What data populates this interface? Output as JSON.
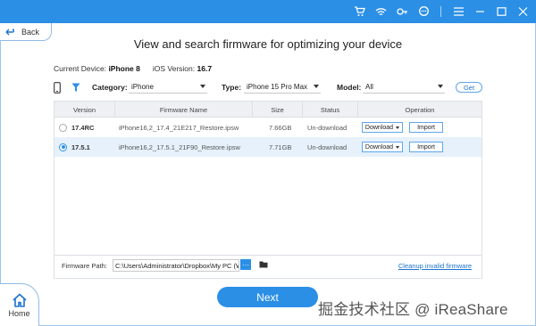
{
  "header": {
    "icons": [
      "cart-icon",
      "wifi-icon",
      "key-icon",
      "chat-icon",
      "menu-icon",
      "minimize-icon",
      "maximize-icon",
      "close-icon"
    ]
  },
  "nav": {
    "back_label": "Back",
    "home_label": "Home"
  },
  "page": {
    "title": "View and search firmware for optimizing your device"
  },
  "device": {
    "current_label": "Current Device:",
    "current_value": "iPhone 8",
    "ios_label": "iOS Version:",
    "ios_value": "16.7"
  },
  "filters": {
    "category_label": "Category:",
    "category_value": "iPhone",
    "type_label": "Type:",
    "type_value": "iPhone 15 Pro Max",
    "model_label": "Model:",
    "model_value": "All",
    "get_label": "Get"
  },
  "table": {
    "columns": [
      "Version",
      "Firmware Name",
      "Size",
      "Status",
      "Operation"
    ],
    "rows": [
      {
        "version": "17.4RC",
        "firmware": "iPhone16,2_17.4_21E217_Restore.ipsw",
        "size": "7.66GB",
        "status": "Un-download",
        "download": "Download",
        "import": "Import",
        "selected": false
      },
      {
        "version": "17.5.1",
        "firmware": "iPhone16,2_17.5.1_21F90_Restore.ipsw",
        "size": "7.71GB",
        "status": "Un-download",
        "download": "Download",
        "import": "Import",
        "selected": true
      }
    ]
  },
  "path": {
    "label": "Firmware Path:",
    "value": "C:\\Users\\Administrator\\Dropbox\\My PC (W",
    "browse_label": "···",
    "cleanup_label": "Cleanup invalid firmware"
  },
  "footer": {
    "next_label": "Next"
  },
  "watermark": "掘金技术社区 @ iReaShare",
  "colors": {
    "accent": "#2b8fe6",
    "link": "#1b73d1",
    "selected_row": "#e6f1fb"
  }
}
